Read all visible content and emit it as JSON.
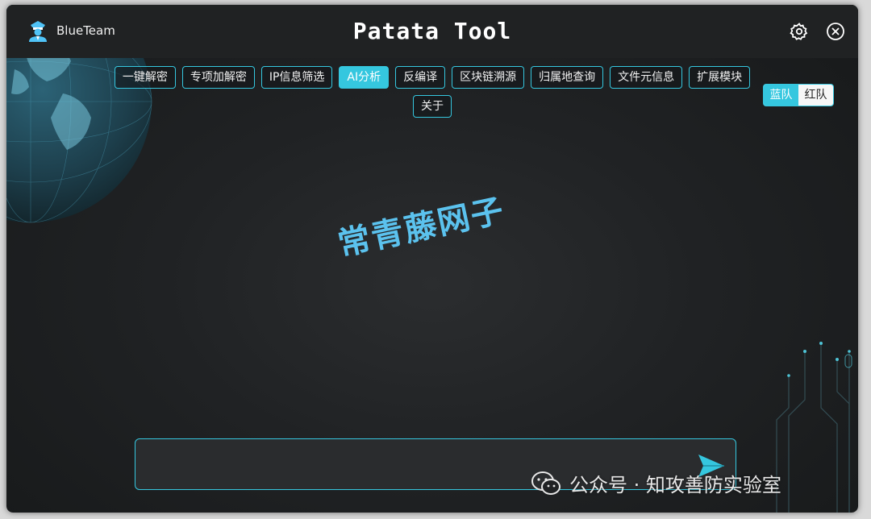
{
  "header": {
    "team_name": "BlueTeam",
    "app_title": "Patata Tool"
  },
  "tabs": [
    {
      "label": "一键解密"
    },
    {
      "label": "专项加解密"
    },
    {
      "label": "IP信息筛选"
    },
    {
      "label": "AI分析",
      "active": true
    },
    {
      "label": "反编译"
    },
    {
      "label": "区块链溯源"
    },
    {
      "label": "归属地查询"
    },
    {
      "label": "文件元信息"
    },
    {
      "label": "扩展模块"
    },
    {
      "label": "关于"
    }
  ],
  "team_toggle": {
    "blue": "蓝队",
    "red": "红队",
    "selected": "blue"
  },
  "overlay_text": "常青藤网子",
  "chat": {
    "input_value": ""
  },
  "footer_watermark": "公众号 · 知攻善防实验室",
  "colors": {
    "accent": "#35c7df",
    "overlay": "#5bc2ee"
  },
  "icons": {
    "brand": "police-officer-icon",
    "settings": "gear-icon",
    "close": "close-circle-icon",
    "send": "send-arrow-icon",
    "wechat": "wechat-icon"
  }
}
